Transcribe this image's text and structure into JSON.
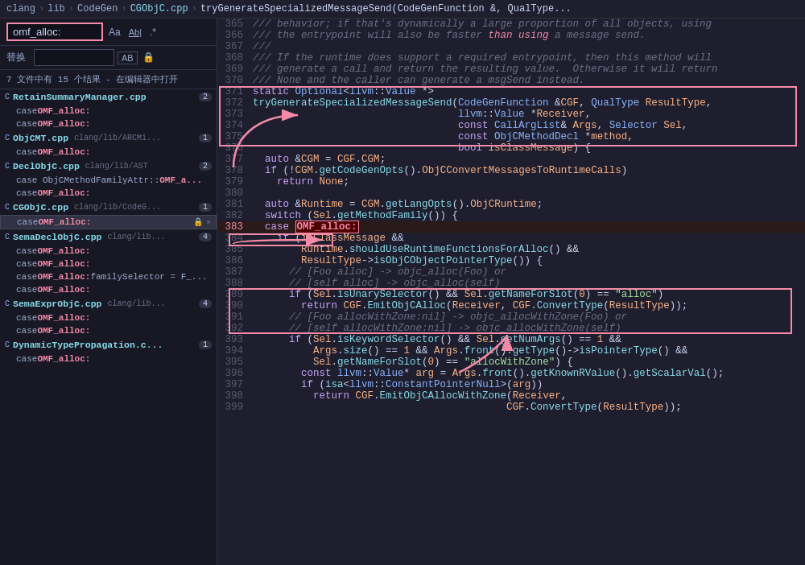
{
  "breadcrumb": {
    "items": [
      "clang",
      "lib",
      "CodeGen",
      "CGObjC.cpp",
      "tryGenerateSpecializedMessageSend(CodeGenFunction &, QualType..."
    ]
  },
  "sidebar": {
    "search_value": "omf_alloc:",
    "replace_label": "替换",
    "replace_value": "",
    "results_info": "7 文件中有 15 个结果 - 在编辑器中打开",
    "files": [
      {
        "icon": "C",
        "name": "RetainSummaryManager.cpp",
        "path": "",
        "count": 2,
        "matches": [
          {
            "text": "case OMF_alloc:",
            "active": false
          },
          {
            "text": "case OMF_alloc:",
            "active": false
          }
        ]
      },
      {
        "icon": "C",
        "name": "ObjCMT.cpp",
        "path": "clang/lib/ARCMi...",
        "count": 1,
        "matches": [
          {
            "text": "case OMF_alloc:",
            "active": false
          }
        ]
      },
      {
        "icon": "C",
        "name": "DeclObjC.cpp",
        "path": "clang/lib/AST",
        "count": 2,
        "matches": [
          {
            "text": "case ObjCMethodFamilyAttr::OMF_a...",
            "active": false
          },
          {
            "text": "case OMF_alloc:",
            "active": false
          }
        ]
      },
      {
        "icon": "C",
        "name": "CGObjC.cpp",
        "path": "clang/lib/CodeG...",
        "count": 1,
        "matches": [
          {
            "text": "case OMF_alloc:",
            "active": true,
            "lock": true,
            "close": true
          }
        ]
      },
      {
        "icon": "C",
        "name": "SemaDeclObjC.cpp",
        "path": "clang/lib...",
        "count": 4,
        "matches": [
          {
            "text": "case OMF_alloc:",
            "active": false
          },
          {
            "text": "case OMF_alloc:",
            "active": false
          },
          {
            "text": "case OMF_alloc: familySelector = F_...",
            "active": false
          },
          {
            "text": "case OMF_alloc:",
            "active": false
          }
        ]
      },
      {
        "icon": "C",
        "name": "SemaExprObjC.cpp",
        "path": "clang/lib...",
        "count": 4,
        "matches": [
          {
            "text": "case OMF_alloc:",
            "active": false
          },
          {
            "text": "case OMF_alloc:",
            "active": false
          }
        ]
      },
      {
        "icon": "C",
        "name": "DynamicTypePropagation.c...",
        "path": "",
        "count": 1,
        "matches": [
          {
            "text": "case OMF_alloc:",
            "active": false
          }
        ]
      }
    ]
  },
  "code": {
    "lines": [
      {
        "num": 365,
        "text": "/// behavior; if that's dynamically a large proportion of all objects, using",
        "type": "comment"
      },
      {
        "num": 366,
        "text": "/// the entrypoint will also be faster than using a message send.",
        "type": "comment"
      },
      {
        "num": 367,
        "text": "///",
        "type": "comment"
      },
      {
        "num": 368,
        "text": "/// If the runtime does support a required entrypoint, then this method will",
        "type": "comment"
      },
      {
        "num": 369,
        "text": "/// generate a call and return the resulting value.  Otherwise it will return",
        "type": "comment"
      },
      {
        "num": 370,
        "text": "/// None and the caller can generate a msgSend instead.",
        "type": "comment"
      },
      {
        "num": 371,
        "text": "static Optional<llvm::Value *>",
        "type": "code"
      },
      {
        "num": 372,
        "text": "tryGenerateSpecializedMessageSend(CodeGenFunction &CGF, QualType ResultType,",
        "type": "code"
      },
      {
        "num": 373,
        "text": "                                  llvm::Value *Receiver,",
        "type": "code"
      },
      {
        "num": 374,
        "text": "                                  const CallArgList& Args, Selector Sel,",
        "type": "code"
      },
      {
        "num": 375,
        "text": "                                  const ObjCMethodDecl *method,",
        "type": "code"
      },
      {
        "num": 376,
        "text": "                                  bool isClassMessage) {",
        "type": "code"
      },
      {
        "num": 377,
        "text": "  auto &CGM = CGF.CGM;",
        "type": "code"
      },
      {
        "num": 378,
        "text": "  if (!CGM.getCodeGenOpts().ObjCConvertMessagesToRuntimeCalls)",
        "type": "code"
      },
      {
        "num": 379,
        "text": "    return None;",
        "type": "code"
      },
      {
        "num": 380,
        "text": "",
        "type": "code"
      },
      {
        "num": 381,
        "text": "  auto &Runtime = CGM.getLangOpts().ObjCRuntime;",
        "type": "code"
      },
      {
        "num": 382,
        "text": "  switch (Sel.getMethodFamily()) {",
        "type": "code"
      },
      {
        "num": 383,
        "text": "  case OMF_alloc:",
        "type": "highlight"
      },
      {
        "num": 384,
        "text": "    if (isClassMessage &&",
        "type": "code"
      },
      {
        "num": 385,
        "text": "        Runtime.shouldUseRuntimeFunctionsForAlloc() &&",
        "type": "code"
      },
      {
        "num": 386,
        "text": "        ResultType->isObjCObjectPointerType()) {",
        "type": "code"
      },
      {
        "num": 387,
        "text": "      // [Foo alloc] -> objc_alloc(Foo) or",
        "type": "comment"
      },
      {
        "num": 388,
        "text": "      // [self alloc] -> objc_alloc(self)",
        "type": "comment"
      },
      {
        "num": 389,
        "text": "      if (Sel.isUnarySelector() && Sel.getNameForSlot(0) == \"alloc\")",
        "type": "code"
      },
      {
        "num": 390,
        "text": "        return CGF.EmitObjCAlloc(Receiver, CGF.ConvertType(ResultType));",
        "type": "code"
      },
      {
        "num": 391,
        "text": "      // [Foo allocWithZone:nil] -> objc_allocWithZone(Foo) or",
        "type": "comment"
      },
      {
        "num": 392,
        "text": "      // [self allocWithZone:nil] -> objc_allocWithZone(self)",
        "type": "comment"
      },
      {
        "num": 393,
        "text": "      if (Sel.isKeywordSelector() && Sel.getNumArgs() == 1 &&",
        "type": "code"
      },
      {
        "num": 394,
        "text": "          Args.size() == 1 && Args.front().getType()->isPointerType() &&",
        "type": "code"
      },
      {
        "num": 395,
        "text": "          Sel.getNameForSlot(0) == \"allocWithZone\") {",
        "type": "code"
      },
      {
        "num": 396,
        "text": "        const llvm::Value* arg = Args.front().getKnownRValue().getScalarVal();",
        "type": "code"
      },
      {
        "num": 397,
        "text": "        if (isa<llvm::ConstantPointerNull>(arg))",
        "type": "code"
      },
      {
        "num": 398,
        "text": "          return CGF.EmitObjCAllocWithZone(Receiver,",
        "type": "code"
      },
      {
        "num": 399,
        "text": "                                          CGF.ConvertType(ResultType));",
        "type": "code"
      }
    ]
  }
}
